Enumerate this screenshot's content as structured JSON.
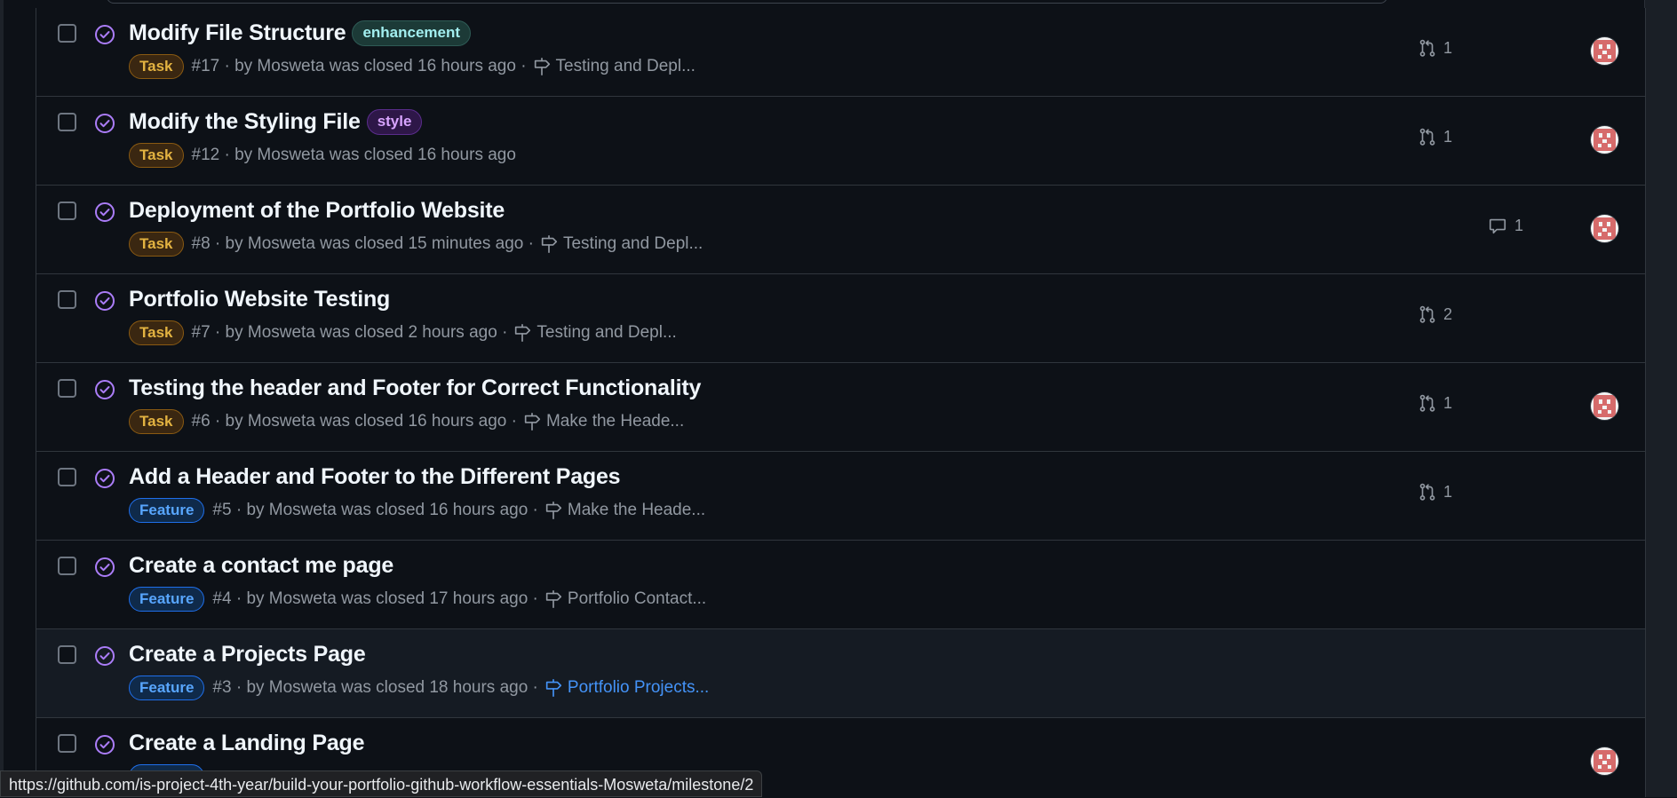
{
  "issues": [
    {
      "title": "Modify File Structure",
      "label": "enhancement",
      "label_kind": "enhancement",
      "type": "Task",
      "type_kind": "task",
      "meta": "#17 · by Mosweta was closed 16 hours ago · ",
      "milestone": "Testing and Depl...",
      "milestone_link": false,
      "prs": "1",
      "comments": "",
      "avatar": true,
      "hover": false
    },
    {
      "title": "Modify the Styling File",
      "label": "style",
      "label_kind": "style",
      "type": "Task",
      "type_kind": "task",
      "meta": "#12 · by Mosweta was closed 16 hours ago",
      "milestone": "",
      "milestone_link": false,
      "prs": "1",
      "comments": "",
      "avatar": true,
      "hover": false
    },
    {
      "title": "Deployment of the Portfolio Website",
      "label": "",
      "label_kind": "",
      "type": "Task",
      "type_kind": "task",
      "meta": "#8 · by Mosweta was closed 15 minutes ago · ",
      "milestone": "Testing and Depl...",
      "milestone_link": false,
      "prs": "",
      "comments": "1",
      "avatar": true,
      "hover": false
    },
    {
      "title": "Portfolio Website Testing",
      "label": "",
      "label_kind": "",
      "type": "Task",
      "type_kind": "task",
      "meta": "#7 · by Mosweta was closed 2 hours ago · ",
      "milestone": "Testing and Depl...",
      "milestone_link": false,
      "prs": "2",
      "comments": "",
      "avatar": false,
      "hover": false
    },
    {
      "title": "Testing the header and Footer for Correct Functionality",
      "label": "",
      "label_kind": "",
      "type": "Task",
      "type_kind": "task",
      "meta": "#6 · by Mosweta was closed 16 hours ago · ",
      "milestone": "Make the Heade...",
      "milestone_link": false,
      "prs": "1",
      "comments": "",
      "avatar": true,
      "hover": false
    },
    {
      "title": "Add a Header and Footer to the Different Pages",
      "label": "",
      "label_kind": "",
      "type": "Feature",
      "type_kind": "feature",
      "meta": "#5 · by Mosweta was closed 16 hours ago · ",
      "milestone": "Make the Heade...",
      "milestone_link": false,
      "prs": "1",
      "comments": "",
      "avatar": false,
      "hover": false
    },
    {
      "title": "Create a contact me page",
      "label": "",
      "label_kind": "",
      "type": "Feature",
      "type_kind": "feature",
      "meta": "#4 · by Mosweta was closed 17 hours ago · ",
      "milestone": "Portfolio Contact...",
      "milestone_link": false,
      "prs": "",
      "comments": "",
      "avatar": false,
      "hover": false
    },
    {
      "title": "Create a Projects Page",
      "label": "",
      "label_kind": "",
      "type": "Feature",
      "type_kind": "feature",
      "meta": "#3 · by Mosweta was closed 18 hours ago · ",
      "milestone": "Portfolio Projects...",
      "milestone_link": true,
      "prs": "",
      "comments": "",
      "avatar": false,
      "hover": true
    },
    {
      "title": "Create a Landing Page",
      "label": "",
      "label_kind": "",
      "type": "Feature",
      "type_kind": "feature",
      "meta": "",
      "milestone": "",
      "milestone_link": false,
      "prs": "",
      "comments": "",
      "avatar": true,
      "hover": false
    }
  ],
  "status_bar": {
    "url": "https://github.com/is-project-4th-year/build-your-portfolio-github-workflow-essentials-Mosweta/milestone/2"
  },
  "colors": {
    "closed_purple": "#ab7df8",
    "task": "#e3b341",
    "feature": "#58a6ff",
    "link": "#4493f8"
  },
  "icons": {
    "state": "issue-closed-icon",
    "pr": "git-pull-request-icon",
    "comment": "comment-icon",
    "milestone": "milestone-icon"
  }
}
